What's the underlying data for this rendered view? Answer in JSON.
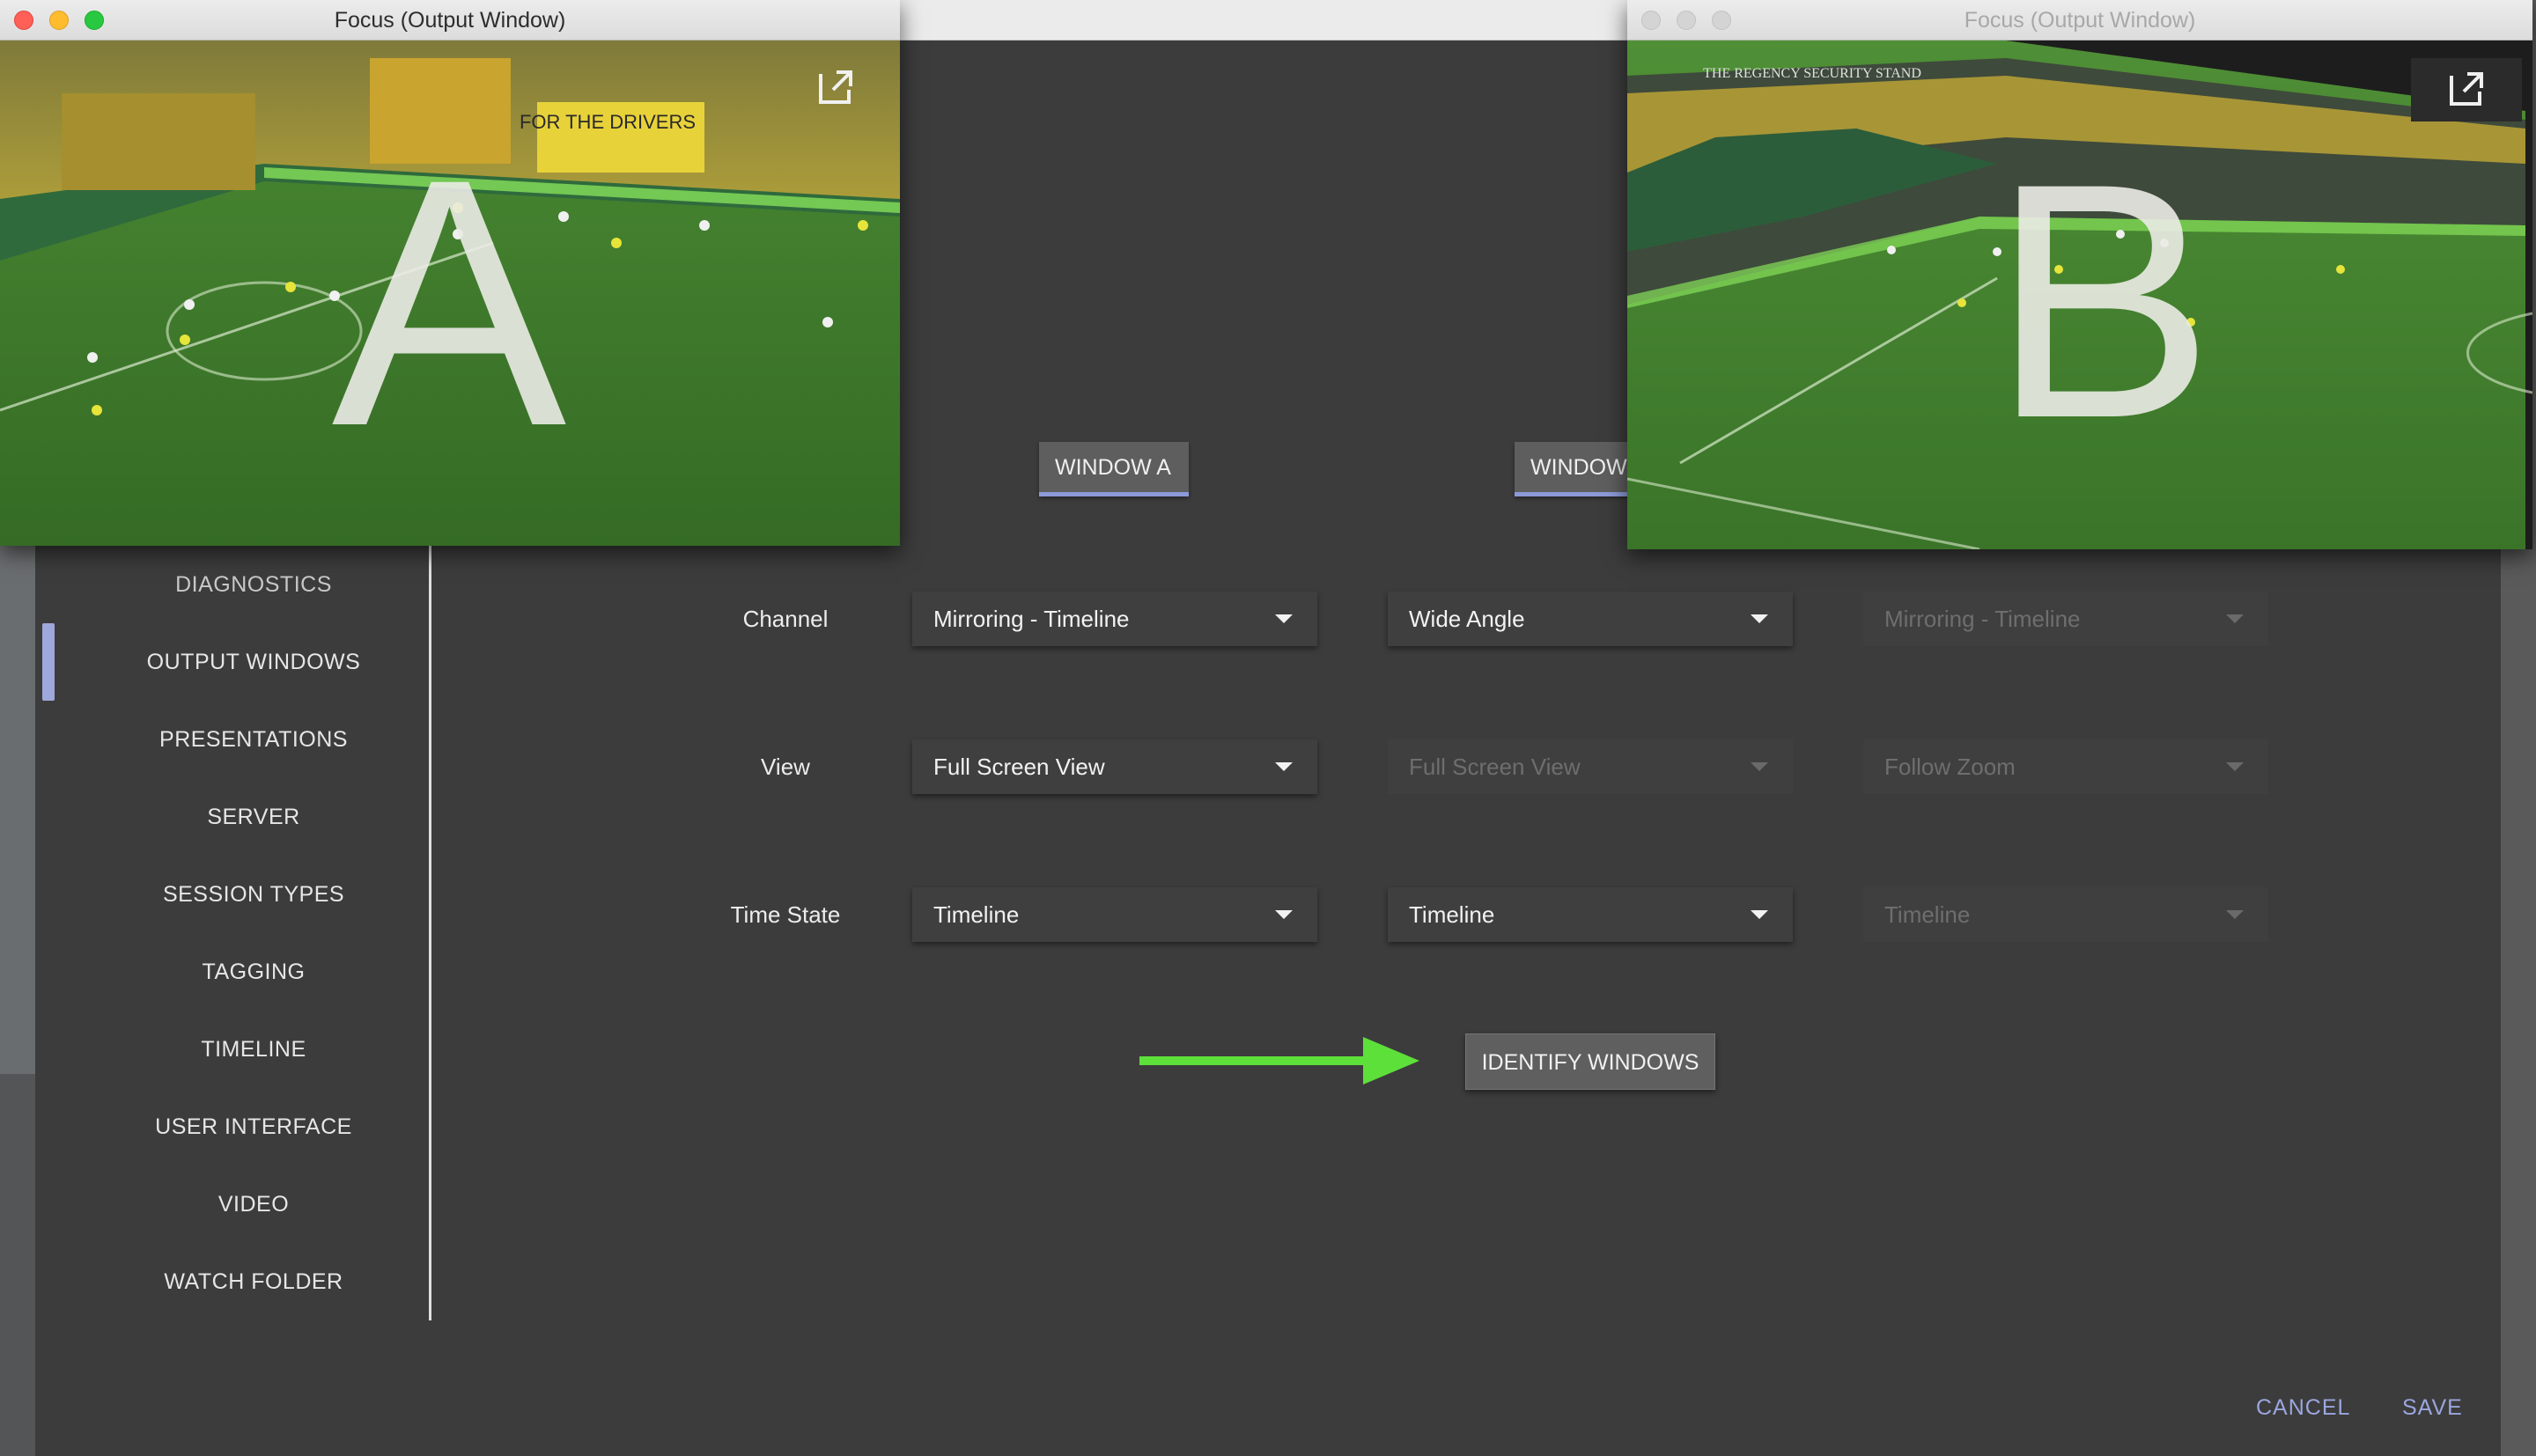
{
  "window_a": {
    "title": "Focus (Output Window)",
    "letter": "A",
    "stadium_banner": "FOR THE DRIVERS",
    "popout_icon": "open-in-new-icon"
  },
  "window_b": {
    "title": "Focus (Output Window)",
    "letter": "B",
    "stadium_banner": "THE REGENCY SECURITY STAND",
    "popout_icon": "open-in-new-icon"
  },
  "sidebar": {
    "items": [
      {
        "label": "DIAGNOSTICS"
      },
      {
        "label": "OUTPUT WINDOWS",
        "active": true
      },
      {
        "label": "PRESENTATIONS"
      },
      {
        "label": "SERVER"
      },
      {
        "label": "SESSION TYPES"
      },
      {
        "label": "TAGGING"
      },
      {
        "label": "TIMELINE"
      },
      {
        "label": "USER INTERFACE"
      },
      {
        "label": "VIDEO"
      },
      {
        "label": "WATCH FOLDER"
      }
    ]
  },
  "tabs": {
    "window_a": "WINDOW A",
    "window_b": "WINDOW B"
  },
  "rows": {
    "channel": {
      "label": "Channel",
      "values": [
        "Mirroring - Timeline",
        "Wide Angle",
        "Mirroring - Timeline"
      ],
      "disabled": [
        false,
        false,
        true
      ]
    },
    "view": {
      "label": "View",
      "values": [
        "Full Screen View",
        "Full Screen View",
        "Follow Zoom"
      ],
      "disabled": [
        false,
        true,
        true
      ]
    },
    "time_state": {
      "label": "Time State",
      "values": [
        "Timeline",
        "Timeline",
        "Timeline"
      ],
      "disabled": [
        false,
        false,
        true
      ]
    }
  },
  "identify_button": "IDENTIFY WINDOWS",
  "footer": {
    "cancel": "CANCEL",
    "save": "SAVE"
  },
  "colors": {
    "accent": "#9fa8da",
    "arrow": "#5ee03a",
    "dialog_bg": "#3c3c3c",
    "pitch": "#3f7a2c"
  }
}
